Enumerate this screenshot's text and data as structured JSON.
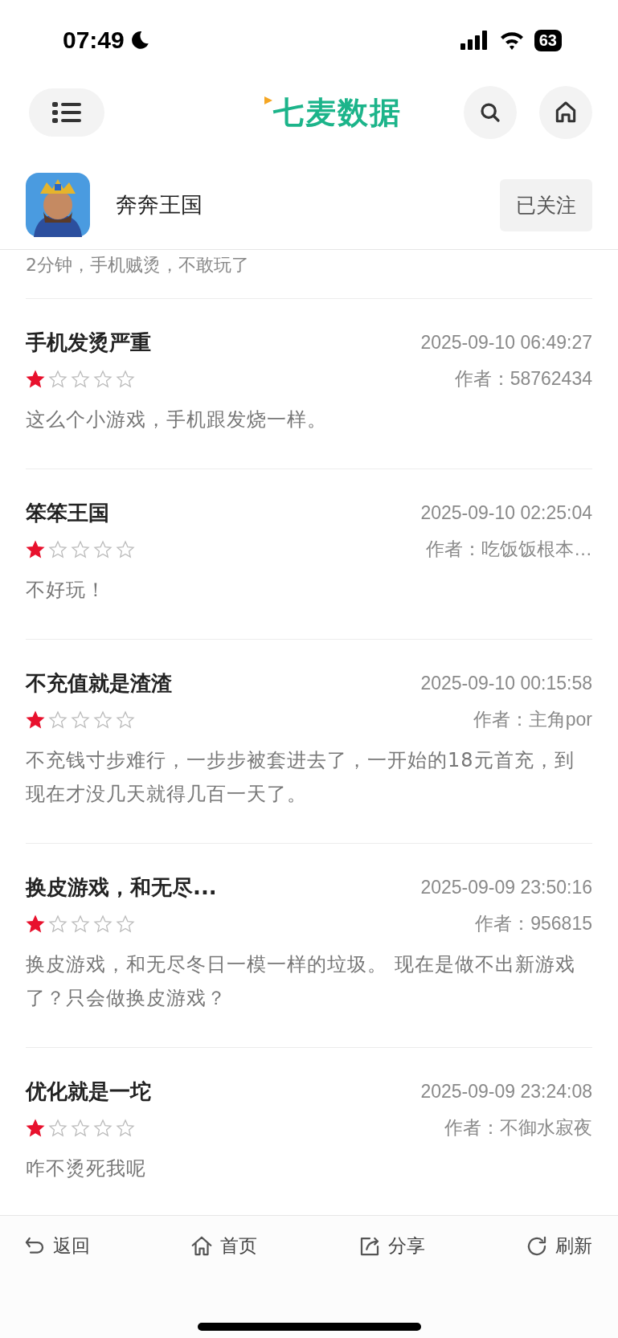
{
  "status_bar": {
    "time": "07:49",
    "battery": "63"
  },
  "nav": {
    "logo": "七麦数据"
  },
  "app": {
    "name": "奔奔王国",
    "follow_button": "已关注"
  },
  "cut_text": "2分钟，手机贼烫，不敢玩了",
  "reviews": [
    {
      "title": "手机发烫严重",
      "date": "2025-09-10 06:49:27",
      "stars": 1,
      "author": "作者：58762434",
      "body": "这么个小游戏，手机跟发烧一样。"
    },
    {
      "title": "笨笨王国",
      "date": "2025-09-10 02:25:04",
      "stars": 1,
      "author": "作者：吃饭饭根本…",
      "body": "不好玩！"
    },
    {
      "title": "不充值就是渣渣",
      "date": "2025-09-10 00:15:58",
      "stars": 1,
      "author": "作者：主角por",
      "body": "不充钱寸步难行，一步步被套进去了，一开始的18元首充，到现在才没几天就得几百一天了。"
    },
    {
      "title": "换皮游戏，和无尽...",
      "date": "2025-09-09 23:50:16",
      "stars": 1,
      "author": "作者：956815",
      "body": "换皮游戏，和无尽冬日一模一样的垃圾。 现在是做不出新游戏了？只会做换皮游戏？"
    },
    {
      "title": "优化就是一坨",
      "date": "2025-09-09 23:24:08",
      "stars": 1,
      "author": "作者：不御水寂夜",
      "body": "咋不烫死我呢"
    }
  ],
  "bottom_bar": [
    {
      "kind": "back",
      "label": "返回"
    },
    {
      "kind": "home",
      "label": "首页"
    },
    {
      "kind": "share",
      "label": "分享"
    },
    {
      "kind": "refresh",
      "label": "刷新"
    }
  ]
}
